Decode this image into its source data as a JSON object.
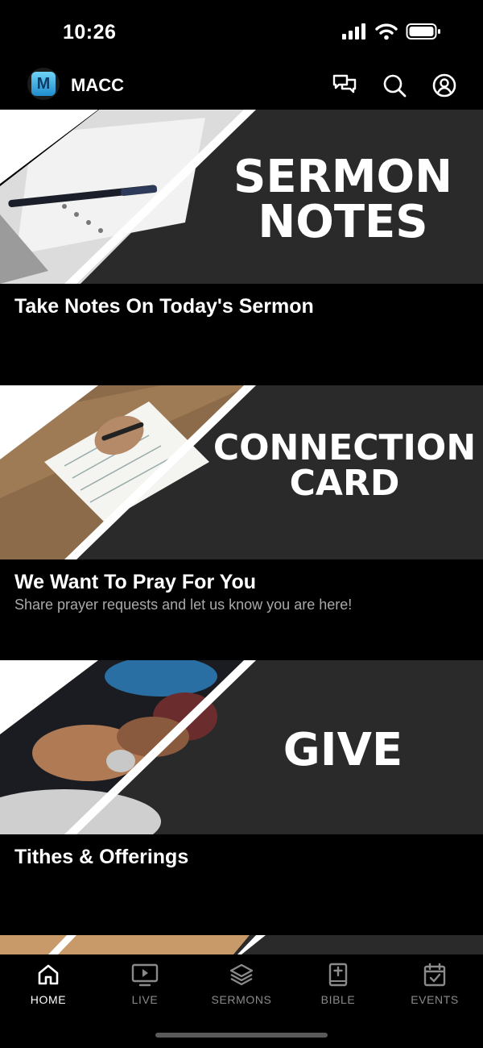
{
  "status_bar": {
    "time": "10:26",
    "icons": [
      "cellular-signal-icon",
      "wifi-icon",
      "battery-icon"
    ]
  },
  "app_bar": {
    "title": "MACC",
    "logo_letter": "M",
    "actions": [
      "chat-icon",
      "search-icon",
      "account-icon"
    ]
  },
  "cards": [
    {
      "banner_lines": [
        "SERMON",
        "NOTES"
      ],
      "title": "Take Notes On Today's Sermon",
      "subtitle": ""
    },
    {
      "banner_lines": [
        "CONNECTION",
        "CARD"
      ],
      "title": "We Want To Pray For You",
      "subtitle": "Share prayer requests and let us know you are here!"
    },
    {
      "banner_lines": [
        "GIVE"
      ],
      "title": "Tithes & Offerings",
      "subtitle": ""
    }
  ],
  "tabs": [
    {
      "label": "HOME",
      "icon": "home-icon",
      "active": true
    },
    {
      "label": "LIVE",
      "icon": "tv-play-icon",
      "active": false
    },
    {
      "label": "SERMONS",
      "icon": "layers-icon",
      "active": false
    },
    {
      "label": "BIBLE",
      "icon": "bible-icon",
      "active": false
    },
    {
      "label": "EVENTS",
      "icon": "calendar-check-icon",
      "active": false
    }
  ],
  "colors": {
    "background": "#000000",
    "banner": "#2a2a2a",
    "active_tab": "#ffffff",
    "inactive_tab": "#8a8a8a",
    "subtitle": "#a9a9a9"
  }
}
